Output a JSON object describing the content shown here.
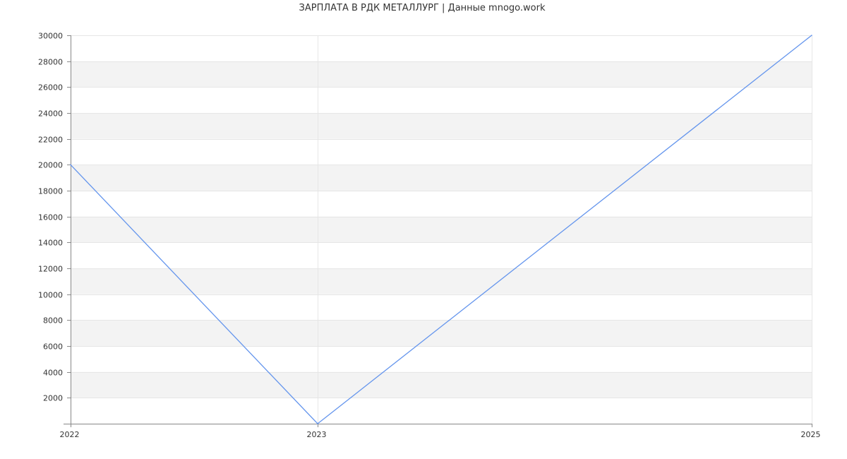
{
  "chart_data": {
    "type": "line",
    "title": "ЗАРПЛАТА В РДК МЕТАЛЛУРГ | Данные mnogo.work",
    "xlabel": "",
    "ylabel": "",
    "x": [
      2022,
      2023,
      2025
    ],
    "x_tick_labels": [
      "2022",
      "2023",
      "2025"
    ],
    "series": [
      {
        "values": [
          20000,
          0,
          30000
        ]
      }
    ],
    "ylim": [
      0,
      30000
    ],
    "y_ticks": [
      2000,
      4000,
      6000,
      8000,
      10000,
      12000,
      14000,
      16000,
      18000,
      20000,
      22000,
      24000,
      26000,
      28000,
      30000
    ],
    "y_tick_labels": [
      "2000",
      "4000",
      "6000",
      "8000",
      "10000",
      "12000",
      "14000",
      "16000",
      "18000",
      "20000",
      "22000",
      "24000",
      "26000",
      "28000",
      "30000"
    ],
    "grid": true,
    "banded_background": true,
    "line_color": "#6495ed",
    "band_color": "#f3f3f3",
    "grid_color": "#e6e6e6",
    "axis_color": "#888888"
  }
}
